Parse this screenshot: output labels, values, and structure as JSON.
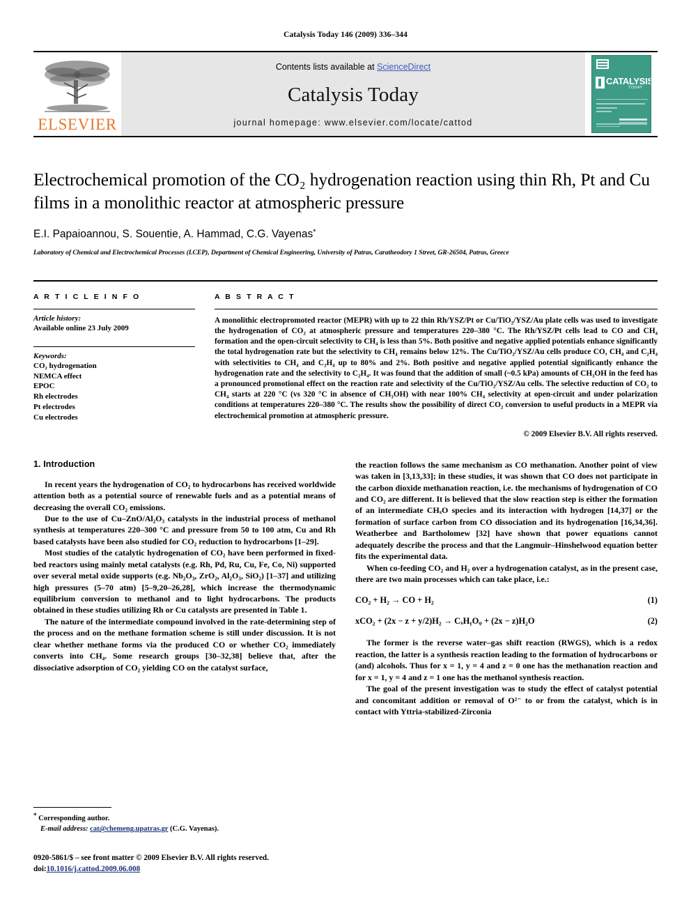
{
  "running_head": "Catalysis Today 146 (2009) 336–344",
  "masthead": {
    "publisher_name": "ELSEVIER",
    "contents_prefix": "Contents lists available at ",
    "sciencedirect": "ScienceDirect",
    "journal_title": "Catalysis Today",
    "homepage": "journal homepage: www.elsevier.com/locate/cattod",
    "cover": {
      "word": "CATALYSIS",
      "sub": "TODAY"
    },
    "colors": {
      "elsevier_orange": "#E8762C",
      "band_gray": "#E6E6E6",
      "link_blue": "#3D5BBF",
      "cover_teal": "#3D9B86"
    }
  },
  "article": {
    "title_line1": "Electrochemical promotion of the CO₂ hydrogenation reaction using thin Rh, Pt",
    "title_line2": "and Cu films in a monolithic reactor at atmospheric pressure",
    "authors": "E.I. Papaioannou, S. Souentie, A. Hammad, C.G. Vayenas",
    "author_marker": "*",
    "affiliation": "Laboratory of Chemical and Electrochemical Processes (LCEP), Department of Chemical Engineering, University of Patras, Caratheodory 1 Street, GR-26504, Patras, Greece"
  },
  "article_info": {
    "heading": "A R T I C L E   I N F O",
    "history_label": "Article history:",
    "history_value": "Available online 23 July 2009",
    "keywords_label": "Keywords:",
    "keywords": [
      "CO₂ hydrogenation",
      "NEMCA effect",
      "EPOC",
      "Rh electrodes",
      "Pt electrodes",
      "Cu electrodes"
    ]
  },
  "abstract": {
    "heading": "A B S T R A C T",
    "text": "A monolithic electropromoted reactor (MEPR) with up to 22 thin Rh/YSZ/Pt or Cu/TiO₂/YSZ/Au plate cells was used to investigate the hydrogenation of CO₂ at atmospheric pressure and temperatures 220–380 °C. The Rh/YSZ/Pt cells lead to CO and CH₄ formation and the open-circuit selectivity to CH₄ is less than 5%. Both positive and negative applied potentials enhance significantly the total hydrogenation rate but the selectivity to CH₄ remains below 12%. The Cu/TiO₂/YSZ/Au cells produce CO, CH₄ and C₂H₄ with selectivities to CH₄ and C₂H₄ up to 80% and 2%. Both positive and negative applied potential significantly enhance the hydrogenation rate and the selectivity to C₂H₄. It was found that the addition of small (~0.5 kPa) amounts of CH₃OH in the feed has a pronounced promotional effect on the reaction rate and selectivity of the Cu/TiO₂/YSZ/Au cells. The selective reduction of CO₂ to CH₄ starts at 220 °C (vs 320 °C in absence of CH₃OH) with near 100% CH₄ selectivity at open-circuit and under polarization conditions at temperatures 220–380 °C. The results show the possibility of direct CO₂ conversion to useful products in a MEPR via electrochemical promotion at atmospheric pressure.",
    "copyright": "© 2009 Elsevier B.V. All rights reserved."
  },
  "body": {
    "section_heading": "1. Introduction",
    "left_paragraphs": [
      "In recent years the hydrogenation of CO₂ to hydrocarbons has received worldwide attention both as a potential source of renewable fuels and as a potential means of decreasing the overall CO₂ emissions.",
      "Due to the use of Cu–ZnO/Al₂O₃ catalysts in the industrial process of methanol synthesis at temperatures 220–300 °C and pressure from 50 to 100 atm, Cu and Rh based catalysts have been also studied for CO₂ reduction to hydrocarbons [1–29].",
      "Most studies of the catalytic hydrogenation of CO₂ have been performed in fixed-bed reactors using mainly metal catalysts (e.g. Rh, Pd, Ru, Cu, Fe, Co, Ni) supported over several metal oxide supports (e.g. Nb₂O₃, ZrO₂, Al₂O₃, SiO₂) [1–37] and utilizing high pressures (5–70 atm) [5–9,20–26,28], which increase the thermodynamic equilibrium conversion to methanol and to light hydrocarbons. The products obtained in these studies utilizing Rh or Cu catalysts are presented in Table 1.",
      "The nature of the intermediate compound involved in the rate-determining step of the process and on the methane formation scheme is still under discussion. It is not clear whether methane forms via the produced CO or whether CO₂ immediately converts into CH₄. Some research groups [30–32,38] believe that, after the dissociative adsorption of CO₂ yielding CO on the catalyst surface,"
    ],
    "right_paragraphs": [
      "the reaction follows the same mechanism as CO methanation. Another point of view was taken in [3,13,33]; in these studies, it was shown that CO does not participate in the carbon dioxide methanation reaction, i.e. the mechanisms of hydrogenation of CO and CO₂ are different. It is believed that the slow reaction step is either the formation of an intermediate CHₓO species and its interaction with hydrogen [14,37] or the formation of surface carbon from CO dissociation and its hydrogenation [16,34,36]. Weatherbee and Bartholomew [32] have shown that power equations cannot adequately describe the process and that the Langmuir–Hinshelwood equation better fits the experimental data.",
      "When co-feeding CO₂ and H₂ over a hydrogenation catalyst, as in the present case, there are two main processes which can take place, i.e.:"
    ],
    "equations": [
      {
        "expr": "CO₂ + H₂ → CO + H₂",
        "number": "(1)"
      },
      {
        "expr": "xCO₂ + (2x − z + y/2)H₂ → CₓHᵧOᵩ + (2x − z)H₂O",
        "number": "(2)"
      }
    ],
    "right_paragraphs_after": [
      "The former is the reverse water–gas shift reaction (RWGS), which is a redox reaction, the latter is a synthesis reaction leading to the formation of hydrocarbons or (and) alcohols. Thus for x = 1, y = 4 and z = 0 one has the methanation reaction and for x = 1, y = 4 and z = 1 one has the methanol synthesis reaction.",
      "The goal of the present investigation was to study the effect of catalyst potential and concomitant addition or removal of O²⁻ to or from the catalyst, which is in contact with Yttria-stabilized-Zirconia"
    ],
    "table_ref": "Table 1"
  },
  "footnote": {
    "corresponding": "Corresponding author.",
    "email_label": "E-mail address:",
    "email": "cat@chemeng.upatras.gr",
    "email_owner": "(C.G. Vayenas)."
  },
  "footer": {
    "issn_line": "0920-5861/$ – see front matter © 2009 Elsevier B.V. All rights reserved.",
    "doi_label": "doi:",
    "doi_value": "10.1016/j.cattod.2009.06.008"
  }
}
